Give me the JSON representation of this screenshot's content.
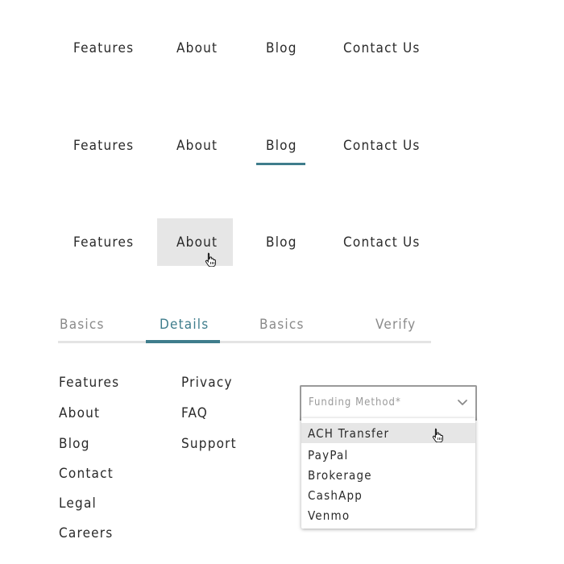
{
  "nav_default": {
    "items": [
      "Features",
      "About",
      "Blog",
      "Contact Us"
    ]
  },
  "nav_active": {
    "items": [
      "Features",
      "About",
      "Blog",
      "Contact Us"
    ],
    "active_item": "Blog"
  },
  "nav_hover": {
    "items": [
      "Features",
      "About",
      "Blog",
      "Contact Us"
    ],
    "hovered_item": "About"
  },
  "step_tabs": {
    "tabs": [
      "Basics",
      "Details",
      "Basics",
      "Verify"
    ],
    "active_tab": "Details"
  },
  "footer_links": {
    "column_1": [
      "Features",
      "About",
      "Blog",
      "Contact",
      "Legal",
      "Careers"
    ],
    "column_2": [
      "Privacy",
      "FAQ",
      "Support"
    ]
  },
  "funding_select": {
    "placeholder": "Funding Method*",
    "options": [
      "ACH Transfer",
      "PayPal",
      "Brokerage",
      "CashApp",
      "Venmo"
    ],
    "highlighted_option": "ACH Transfer"
  },
  "colors": {
    "accent": "#3f7d8c",
    "hover_bg": "#e6e6e6",
    "text": "#2a2a2a",
    "muted": "#8a8a8a"
  },
  "icons": {
    "cursor": "hand-pointer-icon",
    "select": "chevron-down-icon"
  }
}
